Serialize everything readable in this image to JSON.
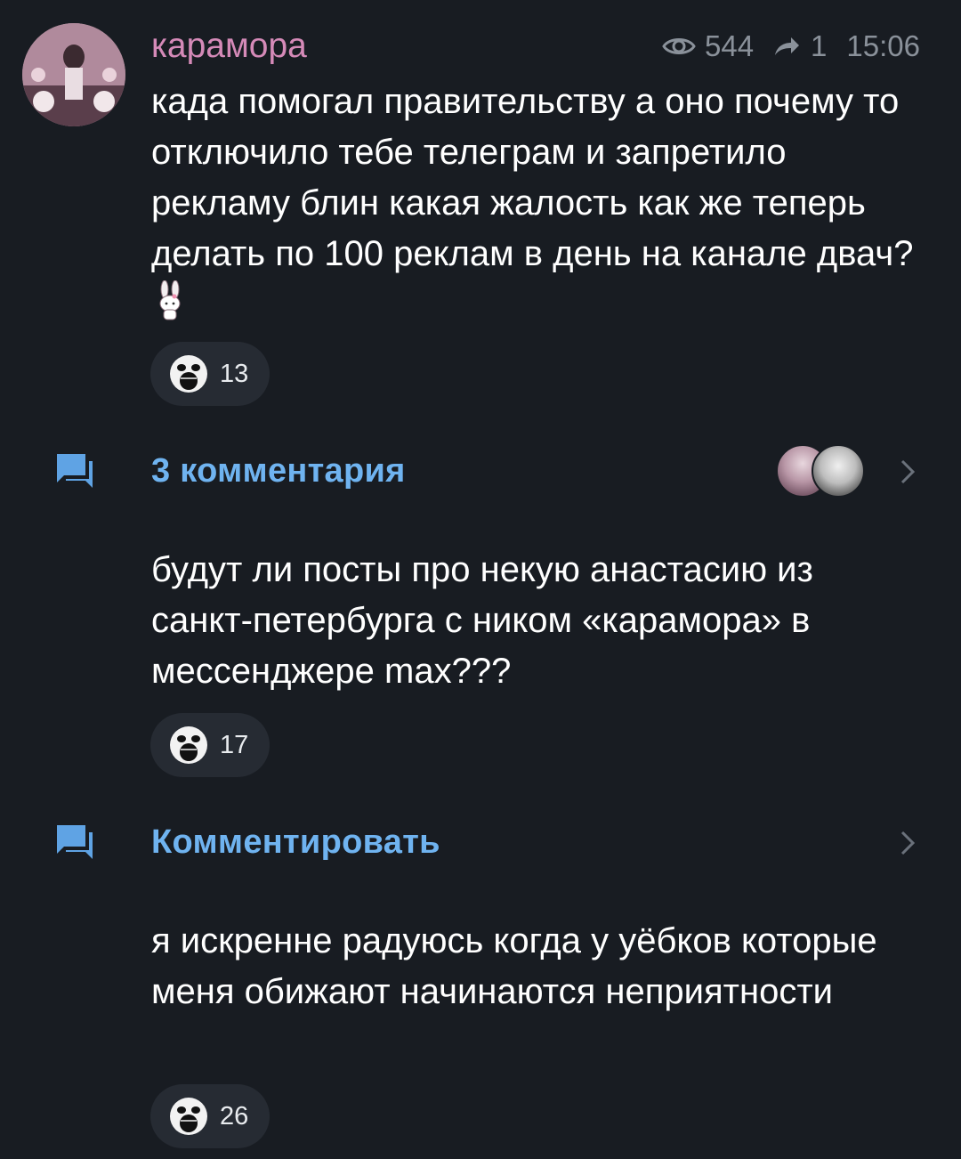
{
  "channel": {
    "author": "карамора",
    "views": "544",
    "shares": "1",
    "time": "15:06",
    "accent_color": "#d58ab8",
    "link_color": "#6fb3f0",
    "background_color": "#181c22"
  },
  "posts": [
    {
      "text": "када помогал правительству а оно почему то отключило тебе телеграм и запретило рекламу блин какая жалость как же теперь делать по 100 реклам в день на канале двач?",
      "emoji": "rabbit-sticker-emoji",
      "reaction_icon": "screaming-face-icon",
      "reaction_count": "13"
    },
    {
      "text": "будут ли посты про некую анастасию из санкт-петербурга с ником «карамора» в мессенджере max???",
      "reaction_icon": "screaming-face-icon",
      "reaction_count": "17"
    },
    {
      "text": "я искренне радуюсь когда у уёбков которые меня обижают начинаются неприятности",
      "reaction_icon": "screaming-face-icon",
      "reaction_count": "26"
    }
  ],
  "comments": [
    {
      "label": "3 комментария",
      "icon": "comment-icon",
      "chevron": "chevron-right-icon"
    },
    {
      "label": "Комментировать",
      "icon": "comment-icon",
      "chevron": "chevron-right-icon"
    }
  ]
}
